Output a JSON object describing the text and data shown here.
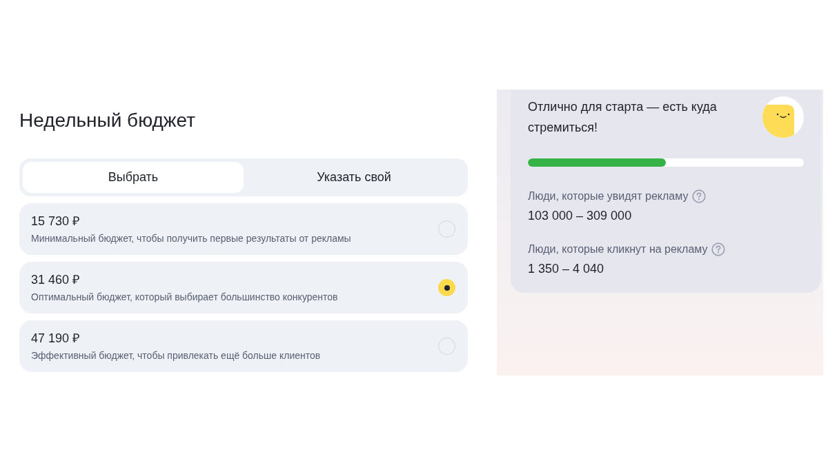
{
  "heading": "Недельный бюджет",
  "tabs": [
    {
      "label": "Выбрать",
      "selected": true
    },
    {
      "label": "Указать свой",
      "selected": false
    }
  ],
  "options": [
    {
      "price": "15 730 ₽",
      "description": "Минимальный бюджет, чтобы получить первые результаты от рекламы",
      "selected": false
    },
    {
      "price": "31 460 ₽",
      "description": "Оптимальный бюджет, который выбирает большинство конкурентов",
      "selected": true
    },
    {
      "price": "47 190 ₽",
      "description": "Эффективный бюджет, чтобы привлекать ещё больше клиентов",
      "selected": false
    }
  ],
  "forecast": {
    "message": "Отлично для старта — есть куда стремиться!",
    "level": 0.5,
    "metrics": [
      {
        "label": "Люди, которые увидят рекламу",
        "value": "103 000 – 309 000"
      },
      {
        "label": "Люди, которые кликнут на рекламу",
        "value": "1 350 – 4 040"
      }
    ]
  }
}
